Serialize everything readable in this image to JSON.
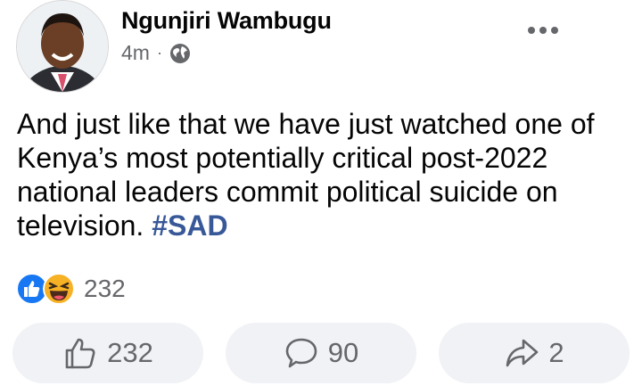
{
  "post": {
    "author": "Ngunjiri Wambugu",
    "time": "4m",
    "separator": "·",
    "privacy_icon": "globe-icon",
    "menu_icon": "more-options-icon",
    "body_text": "And just like that we have just watched one of Kenya’s most potentially critical post-2022 national leaders commit political suicide on television.",
    "hashtag": "#SAD"
  },
  "reactions": {
    "icons": [
      "like-reaction-icon",
      "haha-reaction-icon"
    ],
    "count": "232"
  },
  "actions": {
    "like": {
      "icon": "thumbs-up-icon",
      "count": "232"
    },
    "comment": {
      "icon": "comment-icon",
      "count": "90"
    },
    "share": {
      "icon": "share-icon",
      "count": "2"
    }
  },
  "colors": {
    "text": "#050505",
    "secondary": "#65676b",
    "hashtag": "#385898",
    "button_bg": "#f0f2f5",
    "like_blue": "#1877f2",
    "haha_yellow": "#f7b125"
  }
}
